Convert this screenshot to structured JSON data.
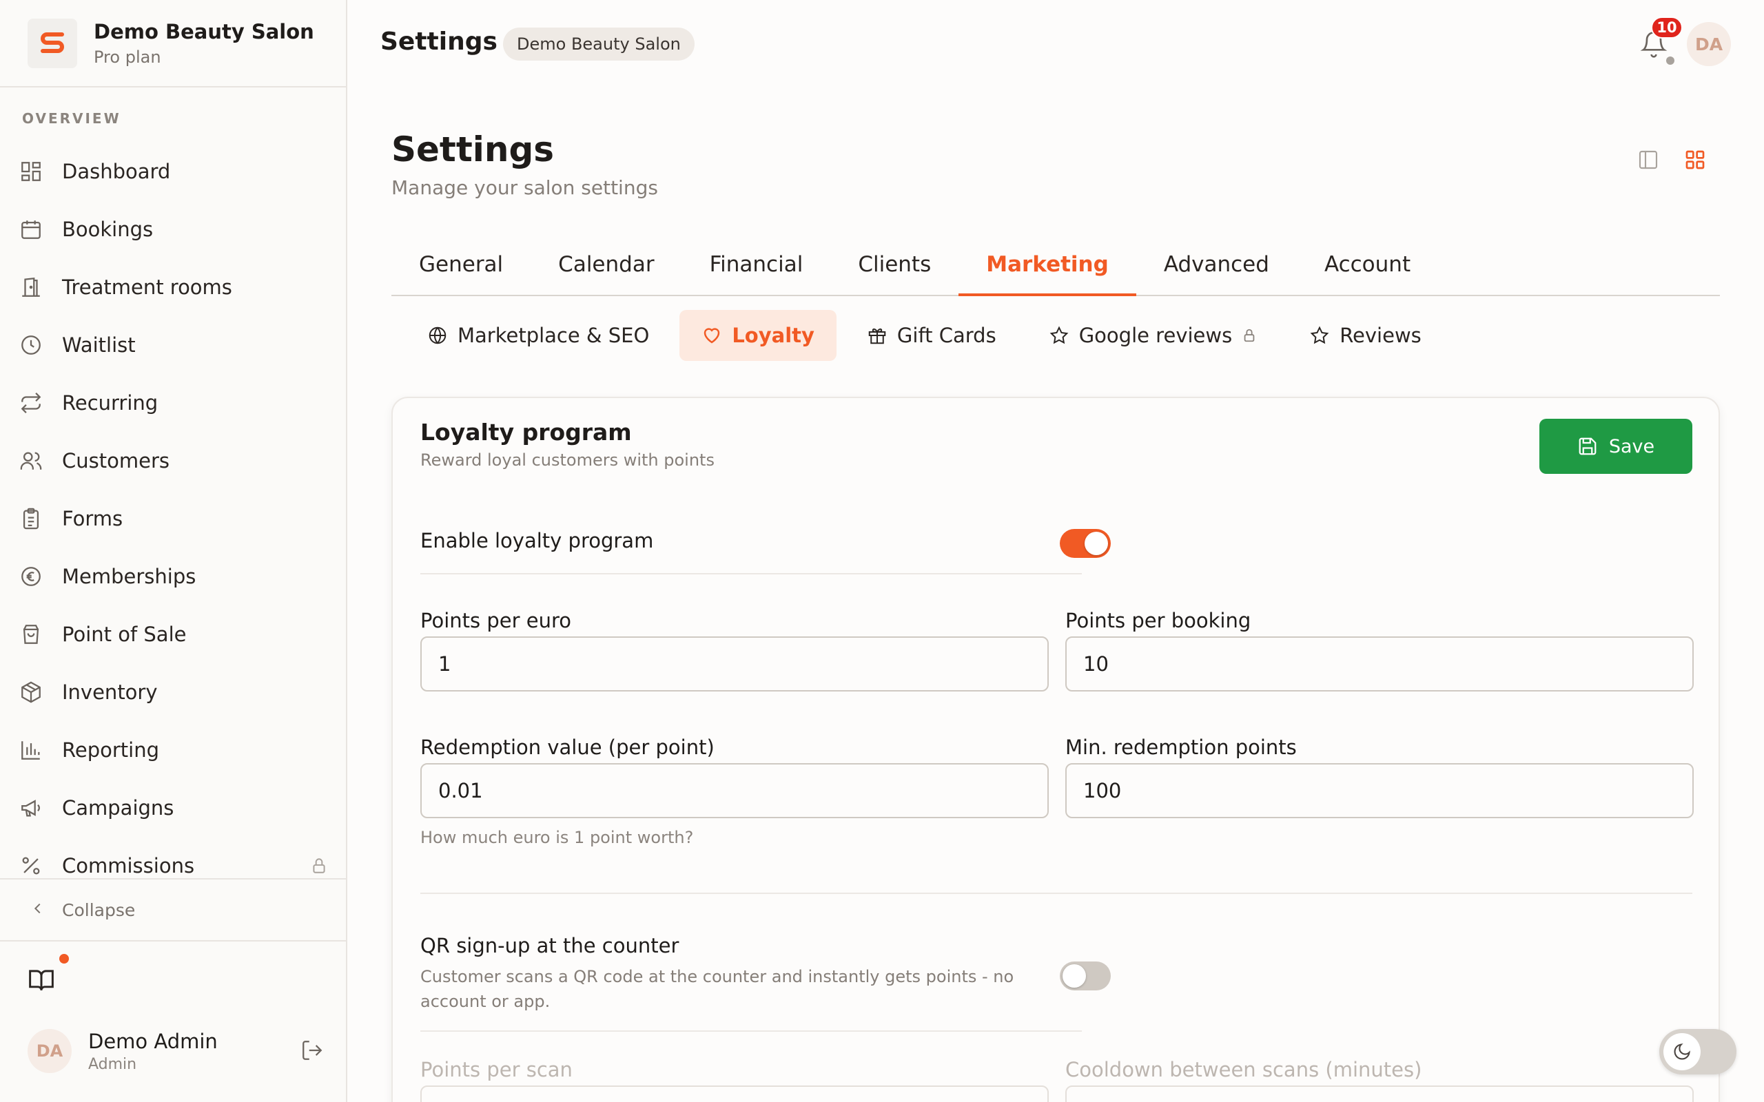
{
  "brand": {
    "name": "Demo Beauty Salon",
    "plan": "Pro plan",
    "logo_letter": "S",
    "accent": "#f15a24"
  },
  "sidebar": {
    "section": "OVERVIEW",
    "items": [
      {
        "label": "Dashboard",
        "icon": "dashboard-icon"
      },
      {
        "label": "Bookings",
        "icon": "calendar-icon"
      },
      {
        "label": "Treatment rooms",
        "icon": "door-icon"
      },
      {
        "label": "Waitlist",
        "icon": "clock-icon"
      },
      {
        "label": "Recurring",
        "icon": "repeat-icon"
      },
      {
        "label": "Customers",
        "icon": "users-icon"
      },
      {
        "label": "Forms",
        "icon": "clipboard-icon"
      },
      {
        "label": "Memberships",
        "icon": "euro-coin-icon"
      },
      {
        "label": "Point of Sale",
        "icon": "shopping-bag-icon"
      },
      {
        "label": "Inventory",
        "icon": "package-icon"
      },
      {
        "label": "Reporting",
        "icon": "bar-chart-icon"
      },
      {
        "label": "Campaigns",
        "icon": "megaphone-icon"
      },
      {
        "label": "Commissions",
        "icon": "percent-icon",
        "locked": true
      }
    ],
    "collapse": "Collapse"
  },
  "user": {
    "name": "Demo Admin",
    "role": "Admin",
    "initials": "DA"
  },
  "topbar": {
    "title": "Settings",
    "salon": "Demo Beauty Salon",
    "notifications": "10",
    "initials": "DA"
  },
  "page": {
    "title": "Settings",
    "subtitle": "Manage your salon settings"
  },
  "tabs": [
    "General",
    "Calendar",
    "Financial",
    "Clients",
    "Marketing",
    "Advanced",
    "Account"
  ],
  "active_tab": "Marketing",
  "subtabs": [
    {
      "label": "Marketplace & SEO",
      "icon": "globe-icon"
    },
    {
      "label": "Loyalty",
      "icon": "heart-icon",
      "active": true
    },
    {
      "label": "Gift Cards",
      "icon": "gift-icon"
    },
    {
      "label": "Google reviews",
      "icon": "star-icon",
      "locked": true
    },
    {
      "label": "Reviews",
      "icon": "star-icon"
    }
  ],
  "loyalty": {
    "title": "Loyalty program",
    "subtitle": "Reward loyal customers with points",
    "save": "Save",
    "enable_label": "Enable loyalty program",
    "enabled": true,
    "points_per_euro_label": "Points per euro",
    "points_per_euro": "1",
    "points_per_booking_label": "Points per booking",
    "points_per_booking": "10",
    "redemption_label": "Redemption value (per point)",
    "redemption": "0.01",
    "redemption_hint": "How much euro is 1 point worth?",
    "min_points_label": "Min. redemption points",
    "min_points": "100",
    "qr_label": "QR sign-up at the counter",
    "qr_desc": "Customer scans a QR code at the counter and instantly gets points - no account or app.",
    "qr_enabled": false,
    "points_per_scan_label": "Points per scan",
    "cooldown_label": "Cooldown between scans (minutes)"
  },
  "colors": {
    "save": "#1f9a44",
    "badge": "#e0241c",
    "accent": "#f15a24"
  }
}
